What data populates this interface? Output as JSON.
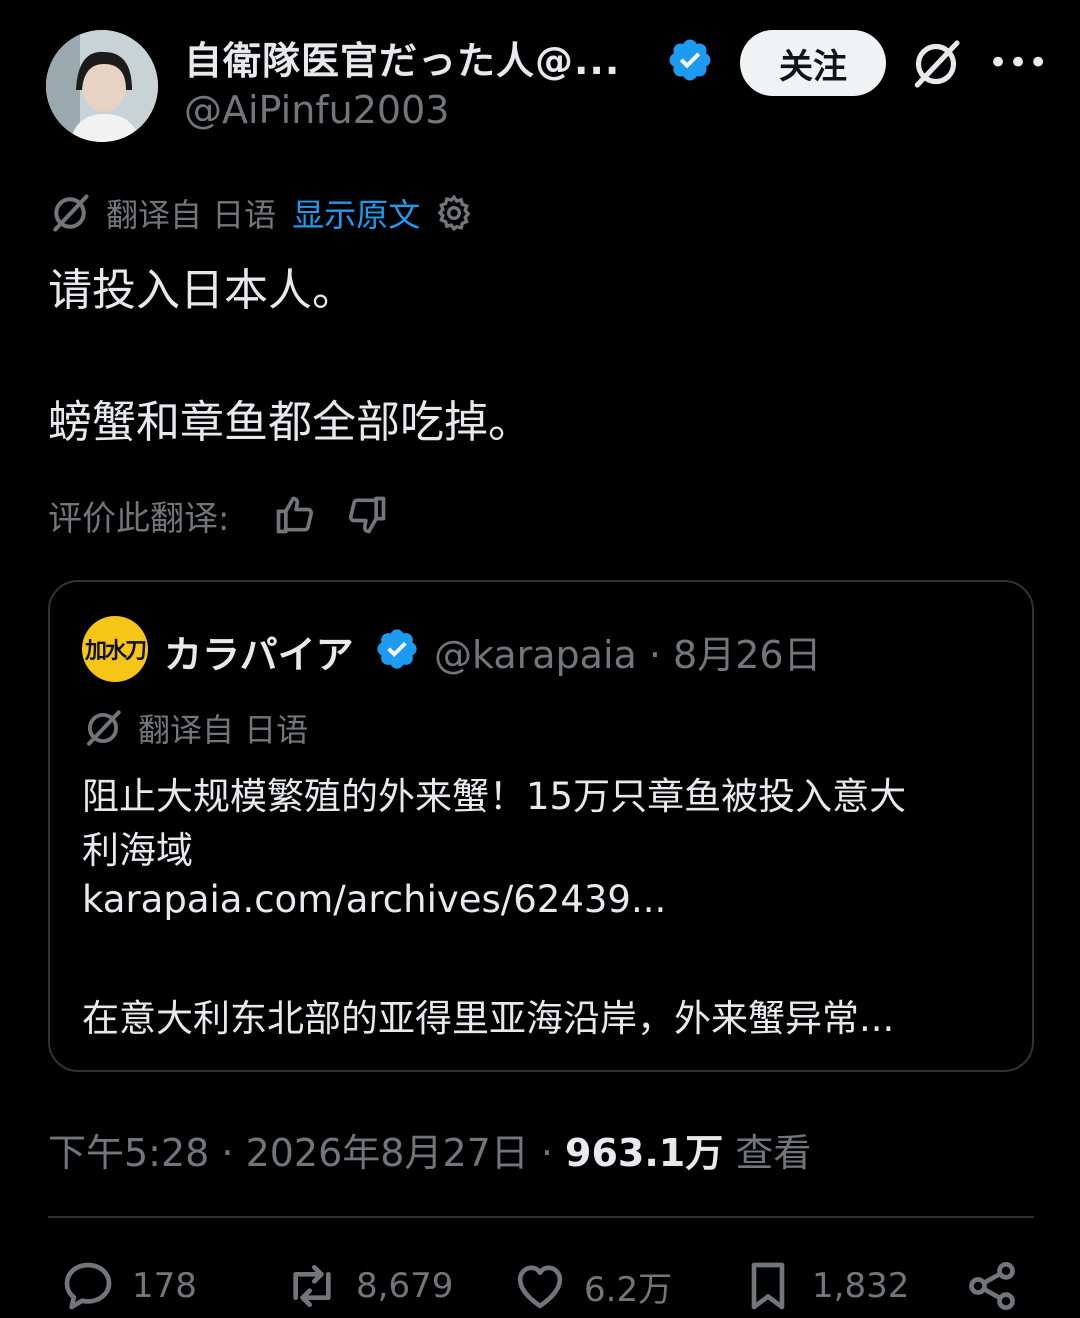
{
  "author": {
    "display_name": "自衛隊医官だった人@...",
    "handle": "@AiPinfu2003",
    "follow_label": "关注",
    "more_label": "•••"
  },
  "translation": {
    "translated_from": "翻译自 日语",
    "show_original": "显示原文"
  },
  "post": {
    "line1": "请投入日本人。",
    "line2": "螃蟹和章鱼都全部吃掉。"
  },
  "rating": {
    "label": "评价此翻译:"
  },
  "quote": {
    "avatar_text": "加水刀",
    "name": "カラパイア",
    "meta": "@karapaia · 8月26日",
    "translated_from": "翻译自 日语",
    "text_line1": "阻止大规模繁殖的外来蟹！15万只章鱼被投入意大",
    "text_line2": "利海域",
    "link": "karapaia.com/archives/62439...",
    "text_line4": "在意大利东北部的亚得里亚海沿岸，外来蟹异常..."
  },
  "meta": {
    "time": "下午5:28 · 2026年8月27日 · ",
    "views_count": "963.1万",
    "views_label": " 查看"
  },
  "actions": {
    "replies": "178",
    "reposts": "8,679",
    "likes": "6.2万",
    "bookmarks": "1,832"
  },
  "colors": {
    "background": "#000000",
    "text": "#e7e9ea",
    "muted": "#71767b",
    "link": "#1d9bf0",
    "verified": "#1d9bf0",
    "border": "#2f3336"
  },
  "icons": [
    "verified-badge-icon",
    "grok-icon",
    "more-icon",
    "translate-icon",
    "gear-icon",
    "thumbs-up-icon",
    "thumbs-down-icon",
    "reply-icon",
    "repost-icon",
    "like-icon",
    "bookmark-icon",
    "share-icon"
  ]
}
